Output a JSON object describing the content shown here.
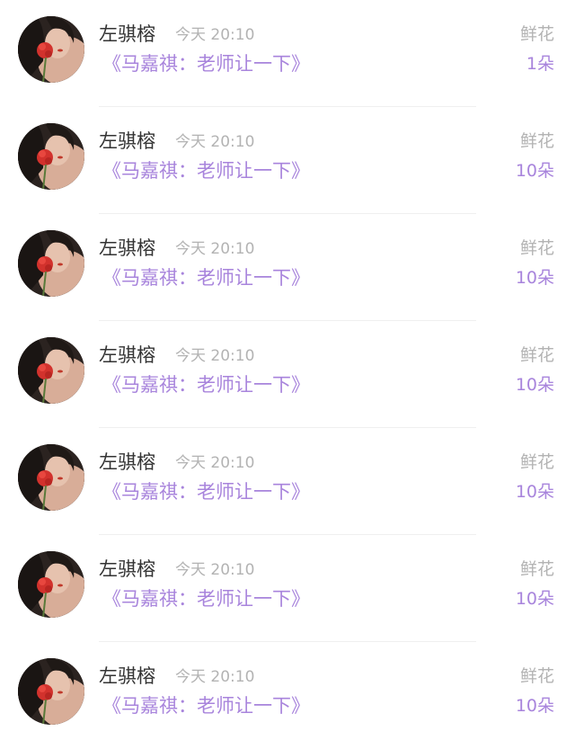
{
  "comments": [
    {
      "name": "左骐榕",
      "time": "今天 20:10",
      "title": "《马嘉祺：老师让一下》",
      "gift_type": "鲜花",
      "gift_count": "1朵",
      "avatar_icon": "avatar-image"
    },
    {
      "name": "左骐榕",
      "time": "今天 20:10",
      "title": "《马嘉祺：老师让一下》",
      "gift_type": "鲜花",
      "gift_count": "10朵",
      "avatar_icon": "avatar-image"
    },
    {
      "name": "左骐榕",
      "time": "今天 20:10",
      "title": "《马嘉祺：老师让一下》",
      "gift_type": "鲜花",
      "gift_count": "10朵",
      "avatar_icon": "avatar-image"
    },
    {
      "name": "左骐榕",
      "time": "今天 20:10",
      "title": "《马嘉祺：老师让一下》",
      "gift_type": "鲜花",
      "gift_count": "10朵",
      "avatar_icon": "avatar-image"
    },
    {
      "name": "左骐榕",
      "time": "今天 20:10",
      "title": "《马嘉祺：老师让一下》",
      "gift_type": "鲜花",
      "gift_count": "10朵",
      "avatar_icon": "avatar-image"
    },
    {
      "name": "左骐榕",
      "time": "今天 20:10",
      "title": "《马嘉祺：老师让一下》",
      "gift_type": "鲜花",
      "gift_count": "10朵",
      "avatar_icon": "avatar-image"
    },
    {
      "name": "左骐榕",
      "time": "今天 20:10",
      "title": "《马嘉祺：老师让一下》",
      "gift_type": "鲜花",
      "gift_count": "10朵",
      "avatar_icon": "avatar-image"
    }
  ],
  "colors": {
    "accent": "#a884dc",
    "muted": "#b3b3b3",
    "name": "#333333",
    "divider": "#f0f0f0"
  }
}
